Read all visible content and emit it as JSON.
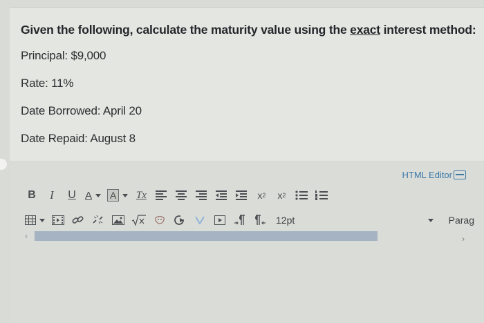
{
  "question": {
    "prompt_before": "Given the following, calculate the maturity value using the ",
    "prompt_emphasis": "exact",
    "prompt_after": " interest method:",
    "principal": "Principal: $9,000",
    "rate": "Rate: 11%",
    "date_borrowed": "Date Borrowed: April 20",
    "date_repaid": "Date Repaid: August 8"
  },
  "editor": {
    "html_editor_label": "HTML Editor",
    "toolbar": {
      "bold": "B",
      "italic": "I",
      "underline": "U",
      "font_color": "A",
      "background_color": "A",
      "clear_formatting": "Tx",
      "superscript": "x",
      "subscript": "x",
      "font_size": "12pt",
      "paragraph": "Parag"
    }
  }
}
